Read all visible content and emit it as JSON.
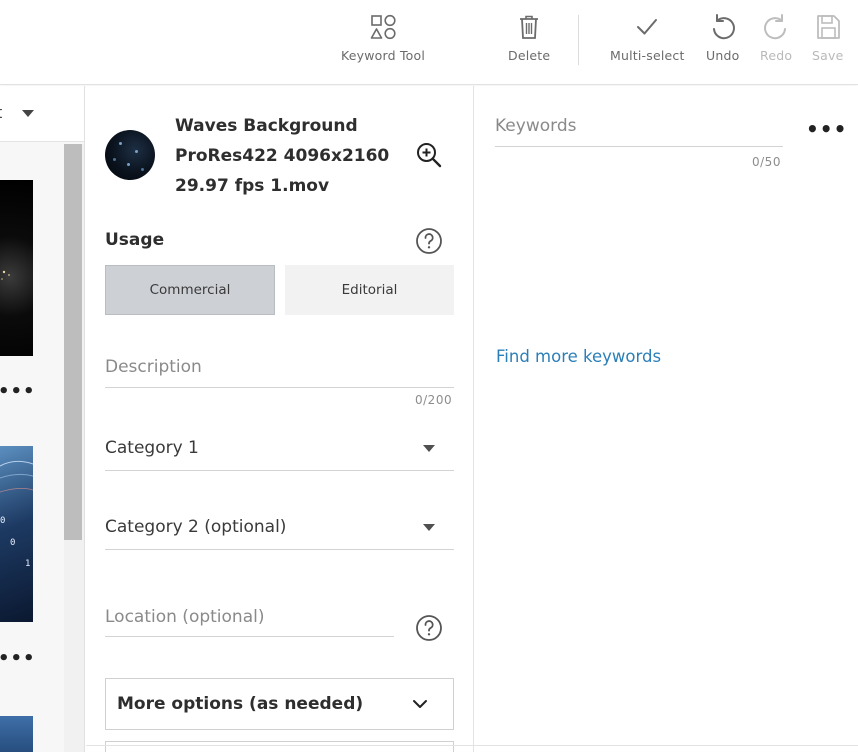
{
  "toolbar": {
    "keyword_tool": "Keyword Tool",
    "delete": "Delete",
    "multi_select": "Multi-select",
    "undo": "Undo",
    "redo": "Redo",
    "save": "Save"
  },
  "left_panel": {
    "sort_text": "t",
    "thumb_more": "•••"
  },
  "file": {
    "title": "Waves Background ProRes422 4096x2160 29.97 fps 1.mov"
  },
  "usage": {
    "title": "Usage",
    "options": [
      "Commercial",
      "Editorial"
    ],
    "selected": "Commercial"
  },
  "description": {
    "placeholder": "Description",
    "counter": "0/200"
  },
  "category1": {
    "label": "Category 1"
  },
  "category2": {
    "label": "Category 2 (optional)"
  },
  "location": {
    "placeholder": "Location (optional)"
  },
  "more_options": {
    "label": "More options (as needed)"
  },
  "keywords": {
    "placeholder": "Keywords",
    "counter": "0/50",
    "more": "•••",
    "find_more": "Find more keywords"
  },
  "colors": {
    "accent_link": "#2b7fb8",
    "selected_segment": "#cdd0d5"
  }
}
